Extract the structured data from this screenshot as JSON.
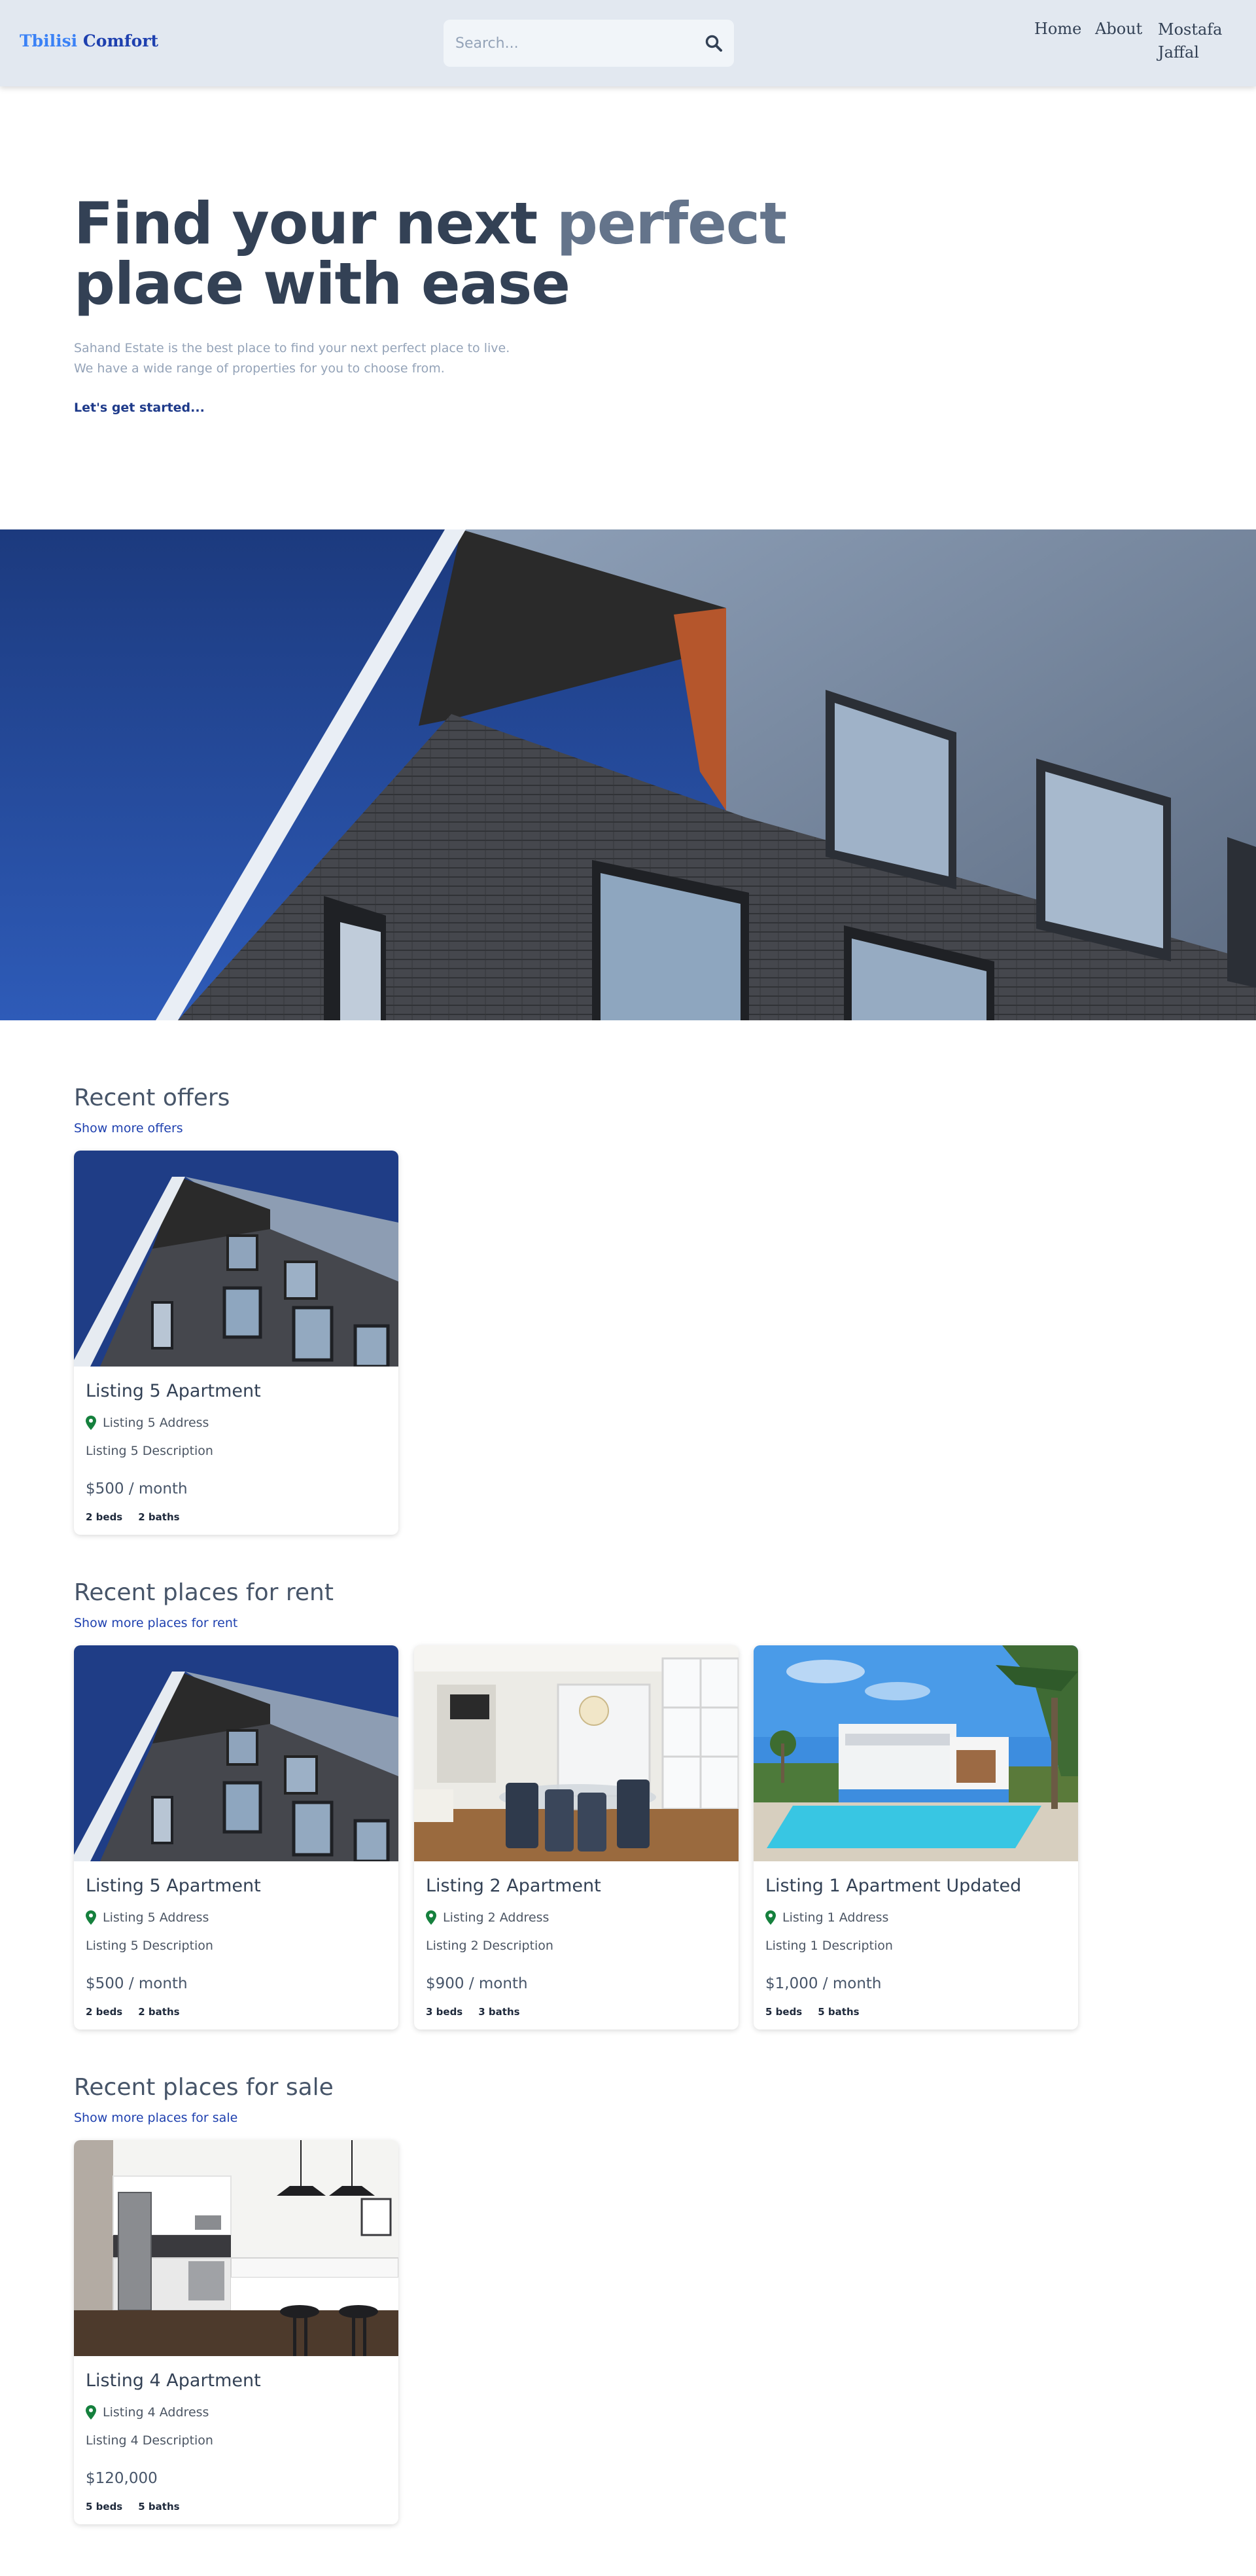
{
  "header": {
    "brand_part1": "Tbilisi",
    "brand_part2": "Comfort",
    "search_placeholder": "Search...",
    "search_icon": "search-icon",
    "nav": {
      "home": "Home",
      "about": "About",
      "user": "Mostafa Jaffal"
    }
  },
  "hero": {
    "title_part1": "Find your next",
    "title_accent": "perfect",
    "title_part2": "place with ease",
    "subtitle_line1": "Sahand Estate is the best place to find your next perfect place to live.",
    "subtitle_line2": "We have a wide range of properties for you to choose from.",
    "cta": "Let's get started..."
  },
  "sections": {
    "offers": {
      "title": "Recent offers",
      "link": "Show more offers",
      "listings": [
        {
          "title": "Listing 5 Apartment",
          "address": "Listing 5 Address",
          "description": "Listing 5 Description",
          "price": "$500 / month",
          "beds": "2 beds",
          "baths": "2 baths",
          "image": "modern-building-photo"
        }
      ]
    },
    "rent": {
      "title": "Recent places for rent",
      "link": "Show more places for rent",
      "listings": [
        {
          "title": "Listing 5 Apartment",
          "address": "Listing 5 Address",
          "description": "Listing 5 Description",
          "price": "$500 / month",
          "beds": "2 beds",
          "baths": "2 baths",
          "image": "modern-building-photo"
        },
        {
          "title": "Listing 2 Apartment",
          "address": "Listing 2 Address",
          "description": "Listing 2 Description",
          "price": "$900 / month",
          "beds": "3 beds",
          "baths": "3 baths",
          "image": "dining-room-photo"
        },
        {
          "title": "Listing 1 Apartment Updated",
          "address": "Listing 1 Address",
          "description": "Listing 1 Description",
          "price": "$1,000 / month",
          "beds": "5 beds",
          "baths": "5 baths",
          "image": "pool-house-photo"
        }
      ]
    },
    "sale": {
      "title": "Recent places for sale",
      "link": "Show more places for sale",
      "listings": [
        {
          "title": "Listing 4 Apartment",
          "address": "Listing 4 Address",
          "description": "Listing 4 Description",
          "price": "$120,000",
          "beds": "5 beds",
          "baths": "5 baths",
          "image": "kitchen-photo"
        }
      ]
    }
  },
  "colors": {
    "brand_light": "#3b82f6",
    "brand_dark": "#1e40af",
    "header_bg": "#e2e8f0",
    "pin_green": "#15803d"
  }
}
